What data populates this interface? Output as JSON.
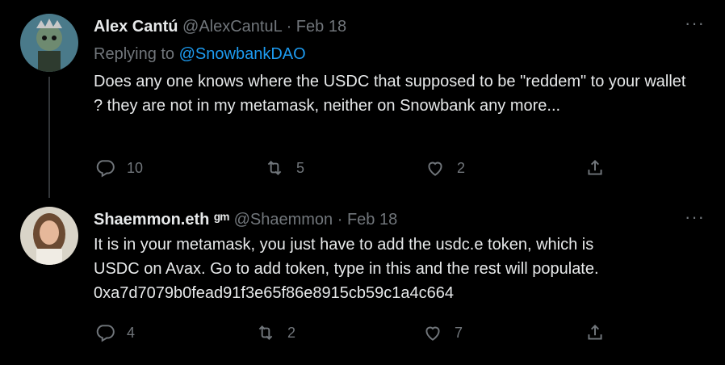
{
  "tweets": [
    {
      "name": "Alex Cantú",
      "handle": "@AlexCantuL",
      "dot": "·",
      "date": "Feb 18",
      "replying_prefix": "Replying to",
      "replying_to": "@SnowbankDAO",
      "text": "Does any one knows where the USDC that supposed to be \"reddem\" to your wallet ? they are not in my metamask, neither on Snowbank any more...",
      "replies": "10",
      "retweets": "5",
      "likes": "2"
    },
    {
      "name": "Shaemmon.eth ᵍᵐ",
      "handle": "@Shaemmon",
      "dot": "·",
      "date": "Feb 18",
      "text_lines": [
        "It is in your metamask, you just have to add the usdc.e token, which is",
        "USDC on Avax.  Go to add token, type in this and the rest will populate.",
        "0xa7d7079b0fead91f3e65f86e8915cb59c1a4c664"
      ],
      "replies": "4",
      "retweets": "2",
      "likes": "7"
    }
  ],
  "more_label": "···",
  "colors": {
    "background": "#000000",
    "text": "#e7e9ea",
    "secondary": "#71767b",
    "link": "#1d9bf0"
  },
  "icons": [
    "reply-icon",
    "retweet-icon",
    "like-icon",
    "share-icon",
    "more-icon"
  ]
}
